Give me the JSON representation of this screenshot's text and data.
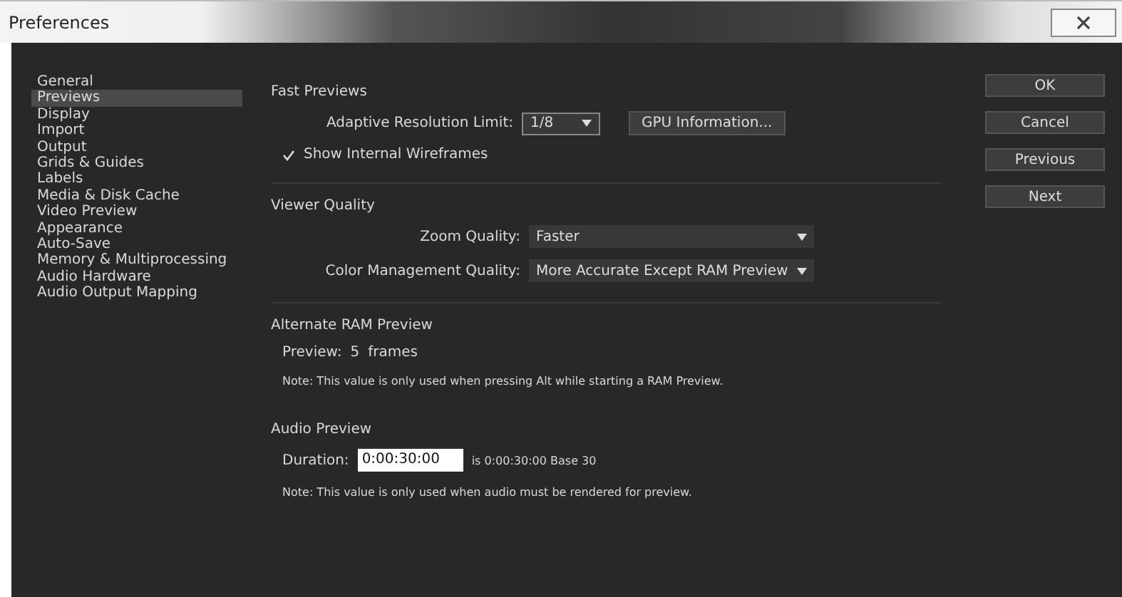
{
  "window": {
    "title": "Preferences"
  },
  "sidebar": {
    "items": [
      {
        "label": "General",
        "selected": false
      },
      {
        "label": "Previews",
        "selected": true
      },
      {
        "label": "Display",
        "selected": false
      },
      {
        "label": "Import",
        "selected": false
      },
      {
        "label": "Output",
        "selected": false
      },
      {
        "label": "Grids & Guides",
        "selected": false
      },
      {
        "label": "Labels",
        "selected": false
      },
      {
        "label": "Media & Disk Cache",
        "selected": false
      },
      {
        "label": "Video Preview",
        "selected": false
      },
      {
        "label": "Appearance",
        "selected": false
      },
      {
        "label": "Auto-Save",
        "selected": false
      },
      {
        "label": "Memory & Multiprocessing",
        "selected": false
      },
      {
        "label": "Audio Hardware",
        "selected": false
      },
      {
        "label": "Audio Output Mapping",
        "selected": false
      }
    ]
  },
  "fast_previews": {
    "heading": "Fast Previews",
    "adaptive_resolution_limit": {
      "label": "Adaptive Resolution Limit:",
      "value": "1/8"
    },
    "gpu_button": "GPU Information...",
    "show_internal_wireframes": {
      "label": "Show Internal Wireframes",
      "checked": true
    }
  },
  "viewer_quality": {
    "heading": "Viewer Quality",
    "zoom_quality": {
      "label": "Zoom Quality:",
      "value": "Faster"
    },
    "color_management_quality": {
      "label": "Color Management Quality:",
      "value": "More Accurate Except RAM Preview"
    }
  },
  "alternate_ram_preview": {
    "heading": "Alternate RAM Preview",
    "preview_label": "Preview:",
    "preview_value": "5",
    "preview_unit": "frames",
    "note": "Note: This value is only used when pressing Alt while starting a RAM Preview."
  },
  "audio_preview": {
    "heading": "Audio Preview",
    "duration_label": "Duration:",
    "duration_value": "0:00:30:00",
    "duration_info": "is 0:00:30:00  Base 30",
    "note": "Note: This value is only used when audio must be rendered for preview."
  },
  "buttons": [
    "OK",
    "Cancel",
    "Previous",
    "Next"
  ]
}
